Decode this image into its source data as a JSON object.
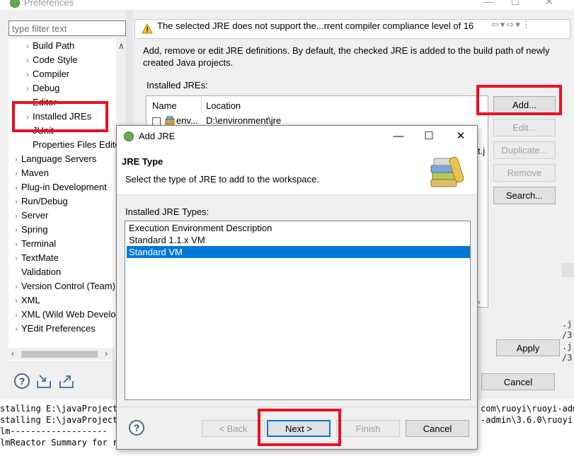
{
  "preferences": {
    "title": "Preferences",
    "filter_placeholder": "type filter text",
    "tree_items": [
      {
        "label": "Build Path",
        "indent": 1,
        "arrow": "›"
      },
      {
        "label": "Code Style",
        "indent": 1,
        "arrow": "›"
      },
      {
        "label": "Compiler",
        "indent": 1,
        "arrow": "›"
      },
      {
        "label": "Debug",
        "indent": 1,
        "arrow": "›"
      },
      {
        "label": "Editor",
        "indent": 1,
        "arrow": "›"
      },
      {
        "label": "Installed JREs",
        "indent": 1,
        "arrow": "›"
      },
      {
        "label": "JUnit",
        "indent": 1,
        "arrow": ""
      },
      {
        "label": "Properties Files Editor",
        "indent": 1,
        "arrow": ""
      },
      {
        "label": "Language Servers",
        "indent": 0,
        "arrow": "›"
      },
      {
        "label": "Maven",
        "indent": 0,
        "arrow": "›"
      },
      {
        "label": "Plug-in Development",
        "indent": 0,
        "arrow": "›"
      },
      {
        "label": "Run/Debug",
        "indent": 0,
        "arrow": "›"
      },
      {
        "label": "Server",
        "indent": 0,
        "arrow": "›"
      },
      {
        "label": "Spring",
        "indent": 0,
        "arrow": "›"
      },
      {
        "label": "Terminal",
        "indent": 0,
        "arrow": "›"
      },
      {
        "label": "TextMate",
        "indent": 0,
        "arrow": "›"
      },
      {
        "label": "Validation",
        "indent": 0,
        "arrow": ""
      },
      {
        "label": "Version Control (Team)",
        "indent": 0,
        "arrow": "›"
      },
      {
        "label": "XML",
        "indent": 0,
        "arrow": "›"
      },
      {
        "label": "XML (Wild Web Developer)",
        "indent": 0,
        "arrow": "›"
      },
      {
        "label": "YEdit Preferences",
        "indent": 0,
        "arrow": "›"
      }
    ],
    "warning_text": "The selected JRE does not support the...rrent compiler compliance level of 16",
    "description": "Add, remove or edit JRE definitions. By default, the checked JRE is added to the build path of newly created Java projects.",
    "installed_jres_label": "Installed JREs:",
    "table": {
      "col_name": "Name",
      "col_location": "Location",
      "row_name": "env...",
      "row_location": "D:\\environment\\jre",
      "row_partial": "t.j"
    },
    "buttons": {
      "add": "Add...",
      "edit": "Edit...",
      "duplicate": "Duplicate...",
      "remove": "Remove",
      "search": "Search...",
      "apply": "Apply",
      "cancel": "Cancel"
    }
  },
  "console": {
    "lines": [
      "stalling E:\\javaProject\\",
      "stalling E:\\javaProject\\",
      "lm-------------------",
      "lmReactor Summary for ru"
    ],
    "right_lines": [
      "com\\ruoyi\\ruoyi-adm",
      "-admin\\3.6.0\\ruoyi-"
    ]
  },
  "dialog": {
    "title": "Add JRE",
    "heading": "JRE Type",
    "description": "Select the type of JRE to add to the workspace.",
    "types_label": "Installed JRE Types:",
    "types": [
      {
        "label": "Execution Environment Description",
        "selected": false
      },
      {
        "label": "Standard 1.1.x VM",
        "selected": false
      },
      {
        "label": "Standard VM",
        "selected": true
      }
    ],
    "buttons": {
      "back": "< Back",
      "next": "Next >",
      "finish": "Finish",
      "cancel": "Cancel"
    }
  },
  "colors": {
    "selection": "#0078d7",
    "highlight_box": "#e81123"
  }
}
